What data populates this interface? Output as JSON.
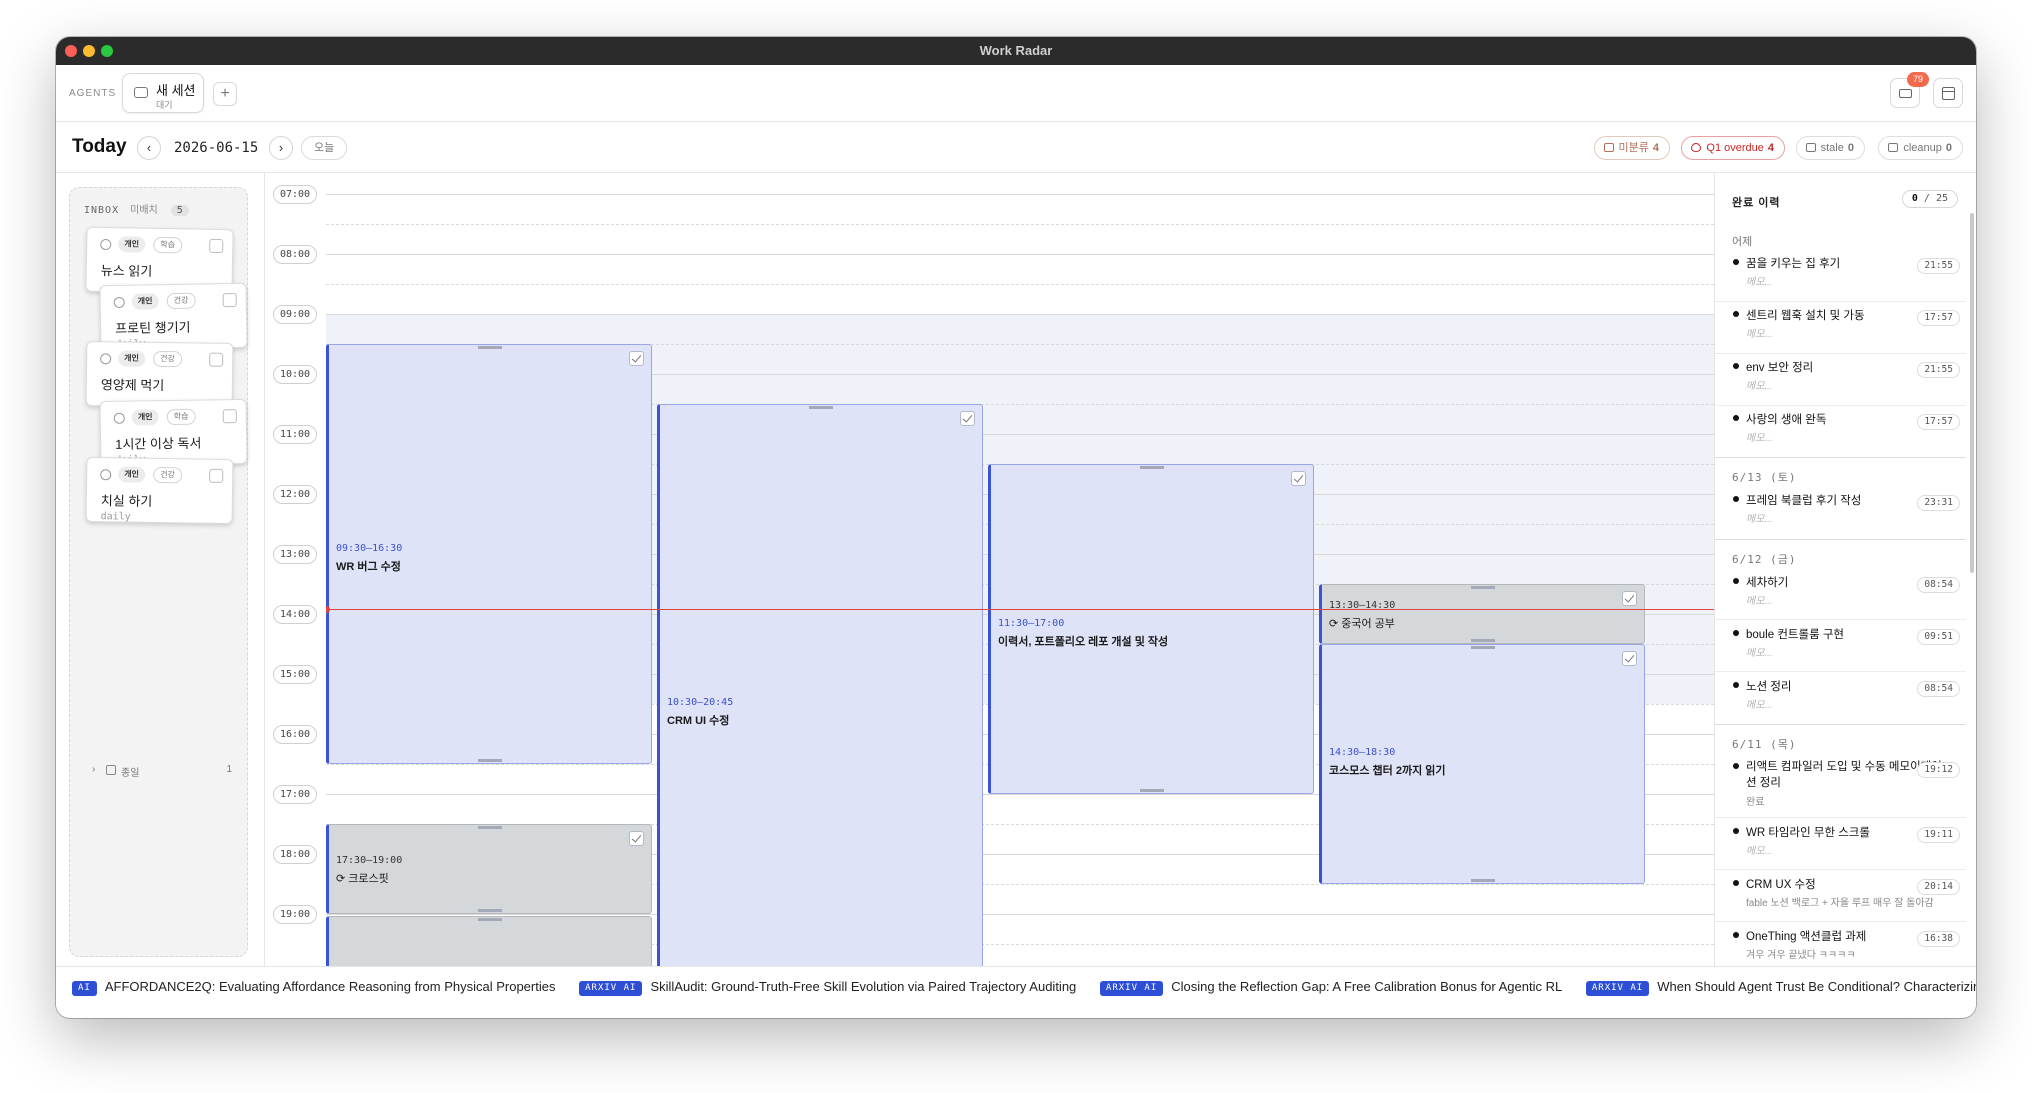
{
  "window": {
    "title": "Work Radar"
  },
  "agents": {
    "label": "AGENTS",
    "session": {
      "title": "새 세션",
      "subtitle": "대기"
    },
    "add": "+",
    "inbox_badge": "79"
  },
  "toolbar": {
    "title": "Today",
    "prev": "‹",
    "next": "›",
    "date": "2026-06-15",
    "today_button": "오늘",
    "chips": [
      {
        "label": "미분류",
        "count": "4"
      },
      {
        "label": "Q1 overdue",
        "count": "4"
      },
      {
        "label": "stale",
        "count": "0"
      },
      {
        "label": "cleanup",
        "count": "0"
      }
    ]
  },
  "inbox": {
    "title": "INBOX",
    "subtitle": "미배치",
    "count": "5",
    "cards": [
      {
        "tag1": "개인",
        "tag2": "학습",
        "title": "뉴스 읽기",
        "footer": ""
      },
      {
        "tag1": "개인",
        "tag2": "건강",
        "title": "프로틴 챙기기",
        "footer": "daily"
      },
      {
        "tag1": "개인",
        "tag2": "건강",
        "title": "영양제 먹기",
        "footer": ""
      },
      {
        "tag1": "개인",
        "tag2": "학습",
        "title": "1시간 이상 독서",
        "footer": "daily"
      },
      {
        "tag1": "개인",
        "tag2": "건강",
        "title": "치실 하기",
        "footer": "daily"
      }
    ],
    "later": {
      "label": "종일",
      "count": "1"
    }
  },
  "timeline": {
    "hours": [
      "07:00",
      "08:00",
      "09:00",
      "10:00",
      "11:00",
      "12:00",
      "13:00",
      "14:00",
      "15:00",
      "16:00",
      "17:00",
      "18:00",
      "19:00"
    ],
    "events": [
      {
        "time": "09:30–16:30",
        "title": "WR 버그 수정",
        "recurring": false
      },
      {
        "time": "10:30–20:45",
        "title": "CRM UI 수정",
        "recurring": false
      },
      {
        "time": "11:30–17:00",
        "title": "이력서, 포트폴리오 레포 개설 및 작성",
        "recurring": false
      },
      {
        "time": "13:30–14:30",
        "title": "⟳ 중국어 공부",
        "recurring": true
      },
      {
        "time": "14:30–18:30",
        "title": "코스모스 챕터 2까지 읽기",
        "recurring": false
      },
      {
        "time": "17:30–19:00",
        "title": "⟳ 크로스핏",
        "recurring": true
      },
      {
        "time": "",
        "title": "",
        "recurring": false
      }
    ]
  },
  "history": {
    "title": "완료 이력",
    "done": "0",
    "total": "/ 25",
    "groups": [
      {
        "label": "어제",
        "items": [
          {
            "title": "꿈을 키우는 집 후기",
            "memo": "메모...",
            "time": "21:55"
          },
          {
            "title": "센트리 웹훅 설치 및 가동",
            "memo": "메모...",
            "time": "17:57"
          },
          {
            "title": "env 보안 정리",
            "memo": "메모...",
            "time": "21:55"
          },
          {
            "title": "사랑의 생애 완독",
            "memo": "메모...",
            "time": "17:57"
          }
        ]
      },
      {
        "label": "6/13 (토)",
        "items": [
          {
            "title": "프레임 북클럽 후기 작성",
            "memo": "메모...",
            "time": "23:31"
          }
        ]
      },
      {
        "label": "6/12 (금)",
        "items": [
          {
            "title": "세차하기",
            "memo": "메모...",
            "time": "08:54"
          },
          {
            "title": "boule 컨트롤룸 구현",
            "memo": "메모...",
            "time": "09:51"
          },
          {
            "title": "노션 정리",
            "memo": "메모...",
            "time": "08:54"
          }
        ]
      },
      {
        "label": "6/11 (목)",
        "items": [
          {
            "title": "리액트 컴파일러 도입 및 수동 메모이제이션 정리",
            "memo": "완료",
            "time": "19:12"
          },
          {
            "title": "WR 타임라인 무한 스크롤",
            "memo": "메모...",
            "time": "19:11"
          },
          {
            "title": "CRM UX 수정",
            "memo": "fable 노션 백로그 + 자율 루프 매우 잘 돌아감",
            "time": "20:14"
          },
          {
            "title": "OneThing 액션클럽 과제",
            "memo": "겨우 겨우 끝냈다 ㅋㅋㅋㅋ",
            "time": "16:38"
          }
        ]
      }
    ]
  },
  "ticker": [
    {
      "source": "AI",
      "title": "AFFORDANCE2Q: Evaluating Affordance Reasoning from Physical Properties"
    },
    {
      "source": "ARXIV AI",
      "title": "SkillAudit: Ground-Truth-Free Skill Evolution via Paired Trajectory Auditing"
    },
    {
      "source": "ARXIV AI",
      "title": "Closing the Reflection Gap: A Free Calibration Bonus for Agentic RL"
    },
    {
      "source": "ARXIV AI",
      "title": "When Should Agent Trust Be Conditional? Characterizing"
    }
  ]
}
